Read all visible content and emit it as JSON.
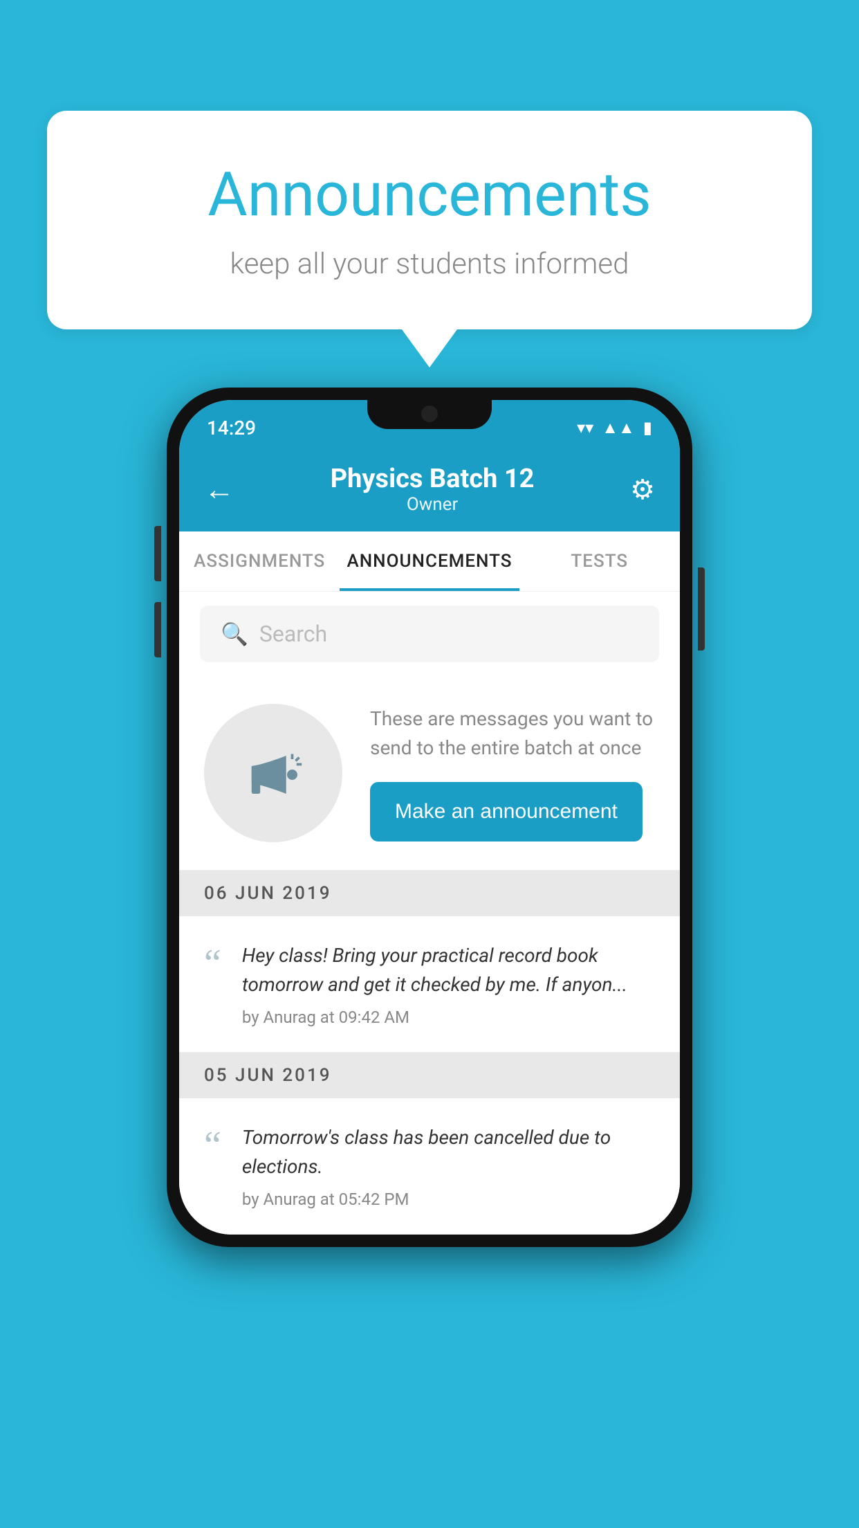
{
  "background_color": "#29b6d8",
  "speech_bubble": {
    "title": "Announcements",
    "subtitle": "keep all your students informed"
  },
  "phone": {
    "status_bar": {
      "time": "14:29",
      "wifi_icon": "▼",
      "signal_icon": "◀",
      "battery_icon": "▮"
    },
    "header": {
      "back_icon": "←",
      "title": "Physics Batch 12",
      "subtitle": "Owner",
      "settings_icon": "⚙"
    },
    "tabs": [
      {
        "label": "ASSIGNMENTS",
        "active": false
      },
      {
        "label": "ANNOUNCEMENTS",
        "active": true
      },
      {
        "label": "TESTS",
        "active": false
      },
      {
        "label": "...",
        "active": false
      }
    ],
    "search": {
      "placeholder": "Search"
    },
    "announce_prompt": {
      "description": "These are messages you want to send to the entire batch at once",
      "button_label": "Make an announcement"
    },
    "announcements": [
      {
        "date": "06  JUN  2019",
        "message": "Hey class! Bring your practical record book tomorrow and get it checked by me. If anyon...",
        "meta": "by Anurag at 09:42 AM"
      },
      {
        "date": "05  JUN  2019",
        "message": "Tomorrow's class has been cancelled due to elections.",
        "meta": "by Anurag at 05:42 PM"
      }
    ]
  }
}
